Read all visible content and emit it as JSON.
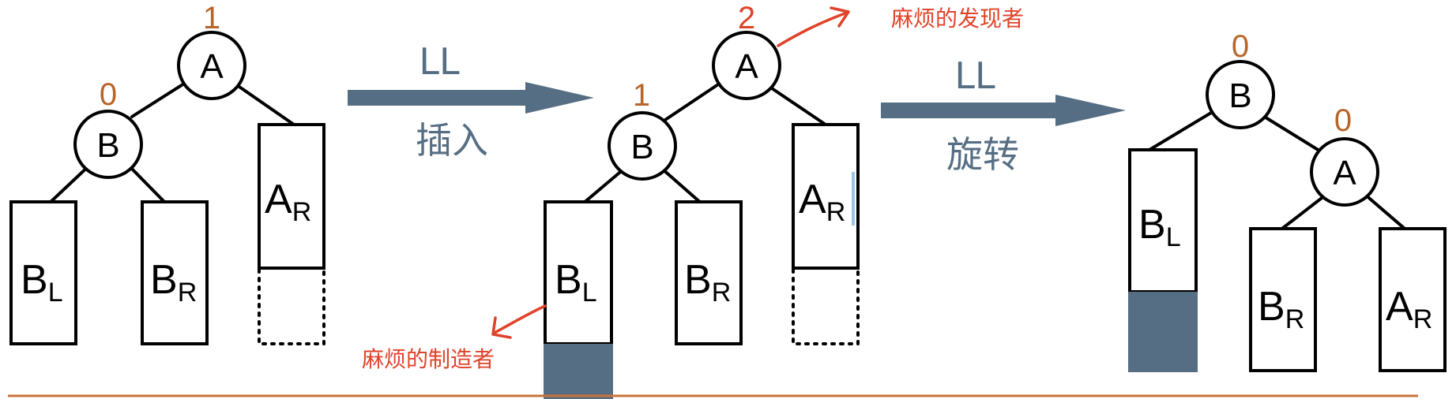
{
  "colors": {
    "balance_factor": "#b8652a",
    "highlight": "#e0432a",
    "arrow": "#566e83",
    "inserted_fill": "#566e83",
    "baseline": "#c8743a"
  },
  "step1": {
    "node_A": "A",
    "node_B": "B",
    "bf_A": "1",
    "bf_B": "0",
    "BL_main": "B",
    "BL_sub": "L",
    "BR_main": "B",
    "BR_sub": "R",
    "AR_main": "A",
    "AR_sub": "R"
  },
  "arrow1": {
    "top": "LL",
    "bottom": "插入"
  },
  "step2": {
    "node_A": "A",
    "node_B": "B",
    "bf_A": "2",
    "bf_B": "1",
    "BL_main": "B",
    "BL_sub": "L",
    "BR_main": "B",
    "BR_sub": "R",
    "AR_main": "A",
    "AR_sub": "R",
    "note_finder": "麻烦的发现者",
    "note_maker": "麻烦的制造者"
  },
  "arrow2": {
    "top": "LL",
    "bottom": "旋转"
  },
  "step3": {
    "node_A": "A",
    "node_B": "B",
    "bf_A": "0",
    "bf_B": "0",
    "BL_main": "B",
    "BL_sub": "L",
    "BR_main": "B",
    "BR_sub": "R",
    "AR_main": "A",
    "AR_sub": "R"
  }
}
